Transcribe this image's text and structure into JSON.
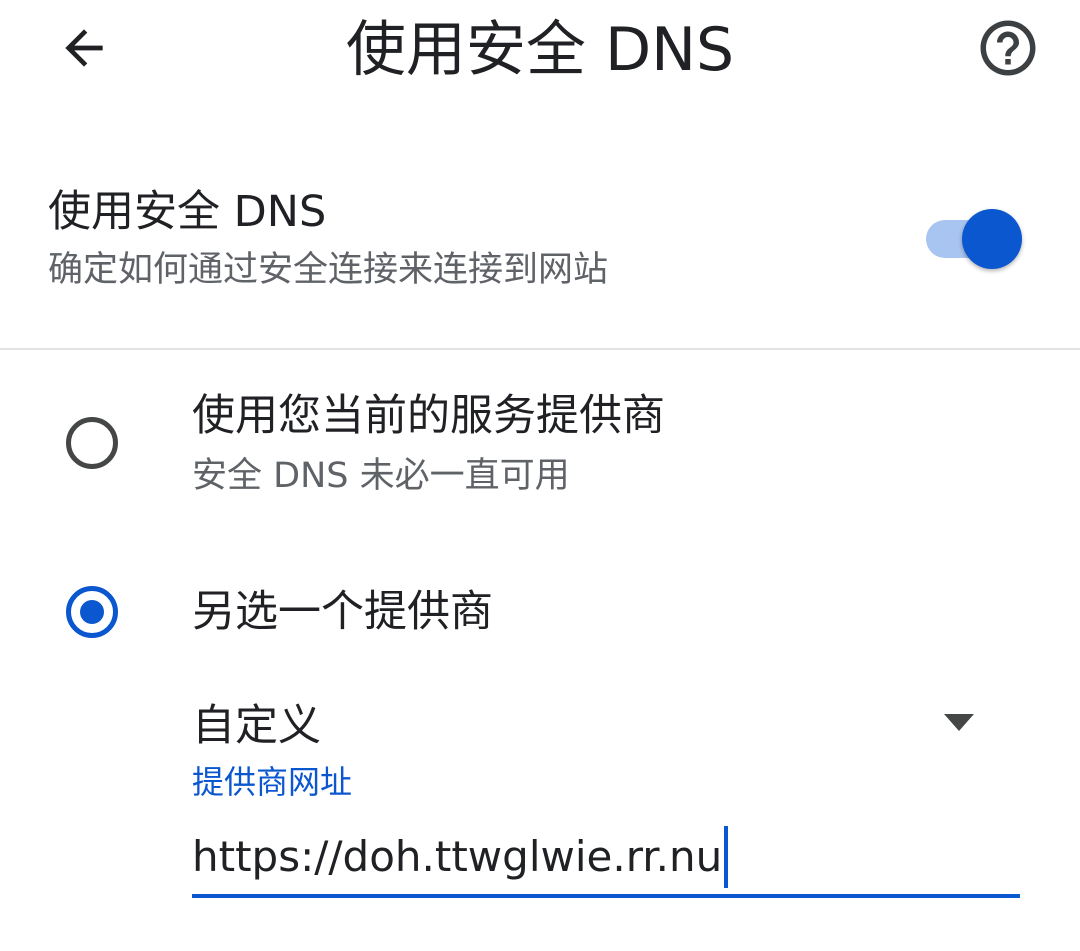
{
  "appbar": {
    "title": "使用安全 DNS",
    "back_icon": "arrow-back-icon",
    "help_icon": "help-circle-icon"
  },
  "secure_dns": {
    "title": "使用安全 DNS",
    "subtitle": "确定如何通过安全连接来连接到网站",
    "enabled": true
  },
  "options": [
    {
      "title": "使用您当前的服务提供商",
      "subtitle": "安全 DNS 未必一直可用",
      "selected": false
    },
    {
      "title": "另选一个提供商",
      "selected": true
    }
  ],
  "provider": {
    "selected": "自定义",
    "url_label": "提供商网址",
    "url_value": "https://doh.ttwglwie.rr.nu"
  },
  "colors": {
    "accent": "#0b57d0",
    "switch_track": "#a8c4f0",
    "text_primary": "#202124",
    "text_secondary": "#5f6368",
    "divider": "#e3e3e3"
  }
}
